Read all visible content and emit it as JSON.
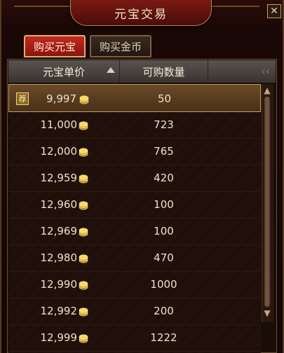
{
  "window": {
    "title": "元宝交易",
    "close_label": "✕"
  },
  "tabs": [
    {
      "label": "购买元宝",
      "active": true
    },
    {
      "label": "购买金币",
      "active": false
    }
  ],
  "table": {
    "headers": {
      "price": "元宝单价",
      "quantity": "可购数量"
    },
    "rows": [
      {
        "price": "9,997",
        "quantity": "50",
        "recommended": true,
        "badge": "荐"
      },
      {
        "price": "11,000",
        "quantity": "723"
      },
      {
        "price": "12,000",
        "quantity": "765"
      },
      {
        "price": "12,959",
        "quantity": "420"
      },
      {
        "price": "12,960",
        "quantity": "100"
      },
      {
        "price": "12,969",
        "quantity": "100"
      },
      {
        "price": "12,980",
        "quantity": "470"
      },
      {
        "price": "12,990",
        "quantity": "1000"
      },
      {
        "price": "12,992",
        "quantity": "200"
      },
      {
        "price": "12,999",
        "quantity": "1222"
      }
    ]
  },
  "colors": {
    "accent": "#c22a20",
    "gold": "#d8b070"
  },
  "icons": {
    "coin": "gold-coin-icon",
    "sort": "sort-asc-icon"
  }
}
